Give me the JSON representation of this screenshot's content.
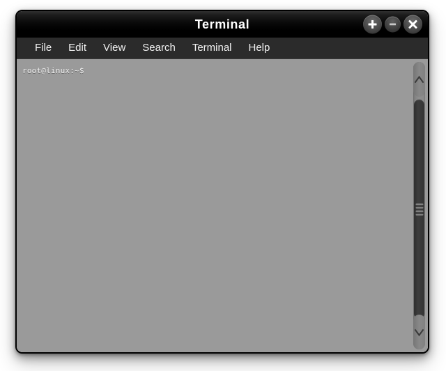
{
  "window": {
    "title": "Terminal",
    "controls": [
      {
        "name": "maximize-button",
        "icon": "plus-icon",
        "label": "+"
      },
      {
        "name": "minimize-button",
        "icon": "minus-icon",
        "label": "−"
      },
      {
        "name": "close-button",
        "icon": "close-icon",
        "label": "×"
      }
    ],
    "colors": {
      "titlebar": "#000000",
      "menubar": "#2b2b2b",
      "terminal_background": "#9a9a9a",
      "terminal_text": "#f0f0f0",
      "scrollbar_thumb": "#343434",
      "scrollbar_track": "#868686",
      "window_border": "#000000"
    }
  },
  "menubar": {
    "items": [
      {
        "label": "File"
      },
      {
        "label": "Edit"
      },
      {
        "label": "View"
      },
      {
        "label": "Search"
      },
      {
        "label": "Terminal"
      },
      {
        "label": "Help"
      }
    ]
  },
  "terminal": {
    "prompt": "root@linux:~$",
    "user": "root",
    "host": "linux",
    "cwd": "~",
    "symbol": "$",
    "lines": [
      "root@linux:~$"
    ]
  },
  "scrollbars": {
    "vertical": {
      "up_arrow_icon": "chevron-up-icon",
      "down_arrow_icon": "chevron-down-icon",
      "grip_icon": "grip-horizontal-icon"
    },
    "horizontal": {
      "left_arrow_icon": "chevron-left-icon",
      "right_arrow_icon": "chevron-right-icon",
      "grip_icon": "grip-vertical-icon"
    }
  }
}
